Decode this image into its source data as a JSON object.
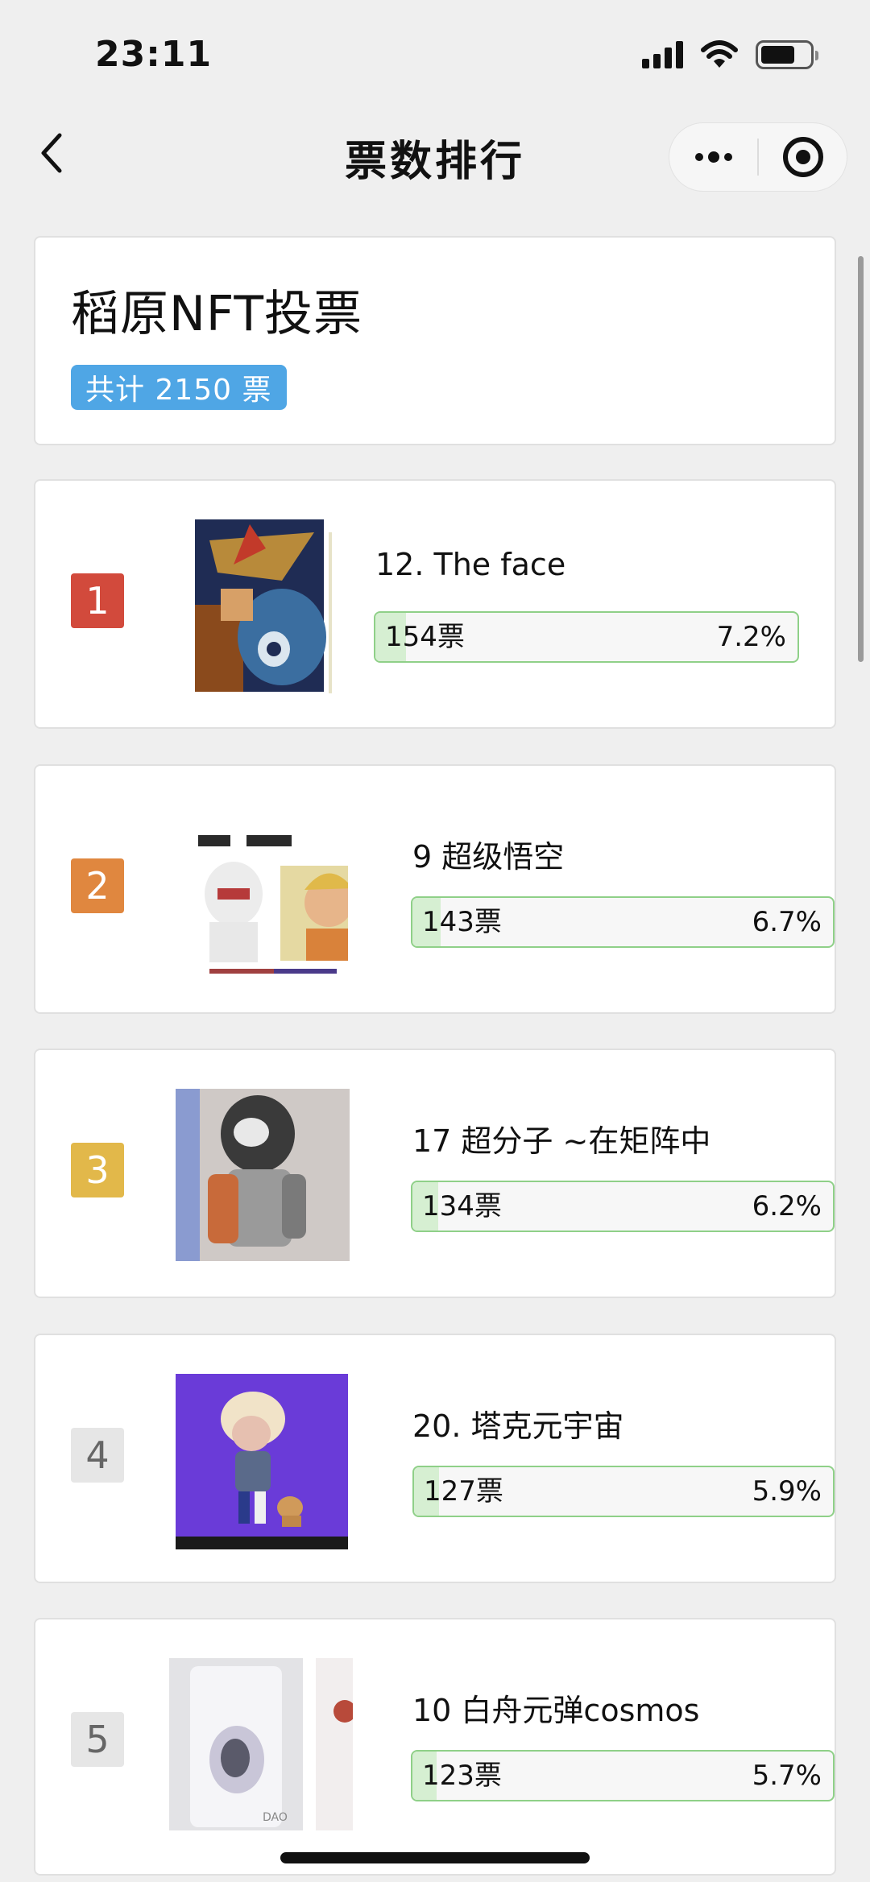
{
  "status_bar": {
    "time": "23:11",
    "battery_level": 0.7
  },
  "nav": {
    "title": "票数排行"
  },
  "poll": {
    "title": "稻原NFT投票",
    "total_label": "共计 2150 票"
  },
  "colors": {
    "rank1": "#d24a3c",
    "rank2": "#e0873f",
    "rank3": "#e2b84a",
    "rank_other": "#e6e6e6",
    "bar_border": "#8fd088",
    "bar_fill": "#d6efd2",
    "badge_blue": "#4fa6e5"
  },
  "ranking": [
    {
      "rank": "1",
      "name": "12. The face",
      "votes": "154票",
      "percent": "7.2%",
      "fraction": 0.072,
      "thumb_icon": "artwork-samurai-image"
    },
    {
      "rank": "2",
      "name": "9 超级悟空",
      "votes": "143票",
      "percent": "6.7%",
      "fraction": 0.067,
      "thumb_icon": "artwork-wukong-image"
    },
    {
      "rank": "3",
      "name": "17 超分子 ~在矩阵中",
      "votes": "134票",
      "percent": "6.2%",
      "fraction": 0.062,
      "thumb_icon": "artwork-robot-figure-image"
    },
    {
      "rank": "4",
      "name": "20. 塔克元宇宙",
      "votes": "127票",
      "percent": "5.9%",
      "fraction": 0.059,
      "thumb_icon": "artwork-figure-dog-image"
    },
    {
      "rank": "5",
      "name": "10 白舟元弹cosmos",
      "votes": "123票",
      "percent": "5.7%",
      "fraction": 0.057,
      "thumb_icon": "artwork-can-image",
      "thumb_text": "DAO"
    }
  ]
}
